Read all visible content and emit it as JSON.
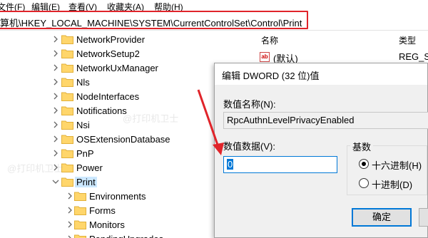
{
  "menubar": {
    "items": [
      "文件(F)",
      "编辑(E)",
      "查看(V)",
      "收藏夹(A)",
      "帮助(H)"
    ]
  },
  "address": {
    "path": "算机\\HKEY_LOCAL_MACHINE\\SYSTEM\\CurrentControlSet\\Control\\Print"
  },
  "tree": {
    "items": [
      {
        "label": "NetworkProvider"
      },
      {
        "label": "NetworkSetup2"
      },
      {
        "label": "NetworkUxManager"
      },
      {
        "label": "Nls"
      },
      {
        "label": "NodeInterfaces"
      },
      {
        "label": "Notifications"
      },
      {
        "label": "Nsi"
      },
      {
        "label": "OSExtensionDatabase"
      },
      {
        "label": "PnP"
      },
      {
        "label": "Power"
      },
      {
        "label": "Print"
      },
      {
        "label": "Environments"
      },
      {
        "label": "Forms"
      },
      {
        "label": "Monitors"
      },
      {
        "label": "PendingUpgrades"
      }
    ]
  },
  "list": {
    "col_name": "名称",
    "col_type": "类型",
    "row_name": "(默认)",
    "row_type": "REG_SZ",
    "row_icon": "ab"
  },
  "dialog": {
    "title": "编辑 DWORD (32 位)值",
    "name_label": "数值名称(N):",
    "name_value": "RpcAuthnLevelPrivacyEnabled",
    "data_label": "数值数据(V):",
    "data_value": "0",
    "base_label": "基数",
    "hex_label": "十六进制(H)",
    "dec_label": "十进制(D)",
    "ok_label": "确定",
    "base_selected": "hex"
  },
  "watermark": "@打印机卫士",
  "colors": {
    "highlight": "#e0242a",
    "selection": "#0078d7",
    "folder": "#ffd66b"
  }
}
